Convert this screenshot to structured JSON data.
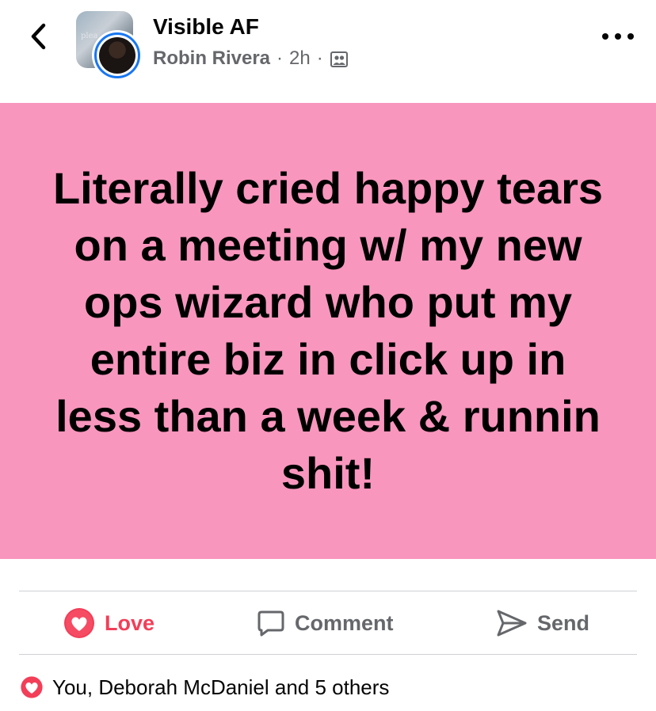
{
  "header": {
    "group_name": "Visible AF",
    "author": "Robin Rivera",
    "time": "2h",
    "separator": "·",
    "group_photo_text": "plea",
    "icons": {
      "back": "chevron-left-icon",
      "privacy": "group-members-icon",
      "more": "more-dots-icon"
    }
  },
  "post": {
    "text": "Literally cried happy tears on a meeting w/ my new ops wizard who put my entire biz in click up in less than a week & runnin shit!",
    "background_color": "#f996bd"
  },
  "actions": {
    "love_label": "Love",
    "comment_label": "Comment",
    "send_label": "Send",
    "love_color": "#f33e58"
  },
  "reactions": {
    "summary": "You, Deborah McDaniel and 5 others",
    "icon": "love-reaction-icon"
  }
}
